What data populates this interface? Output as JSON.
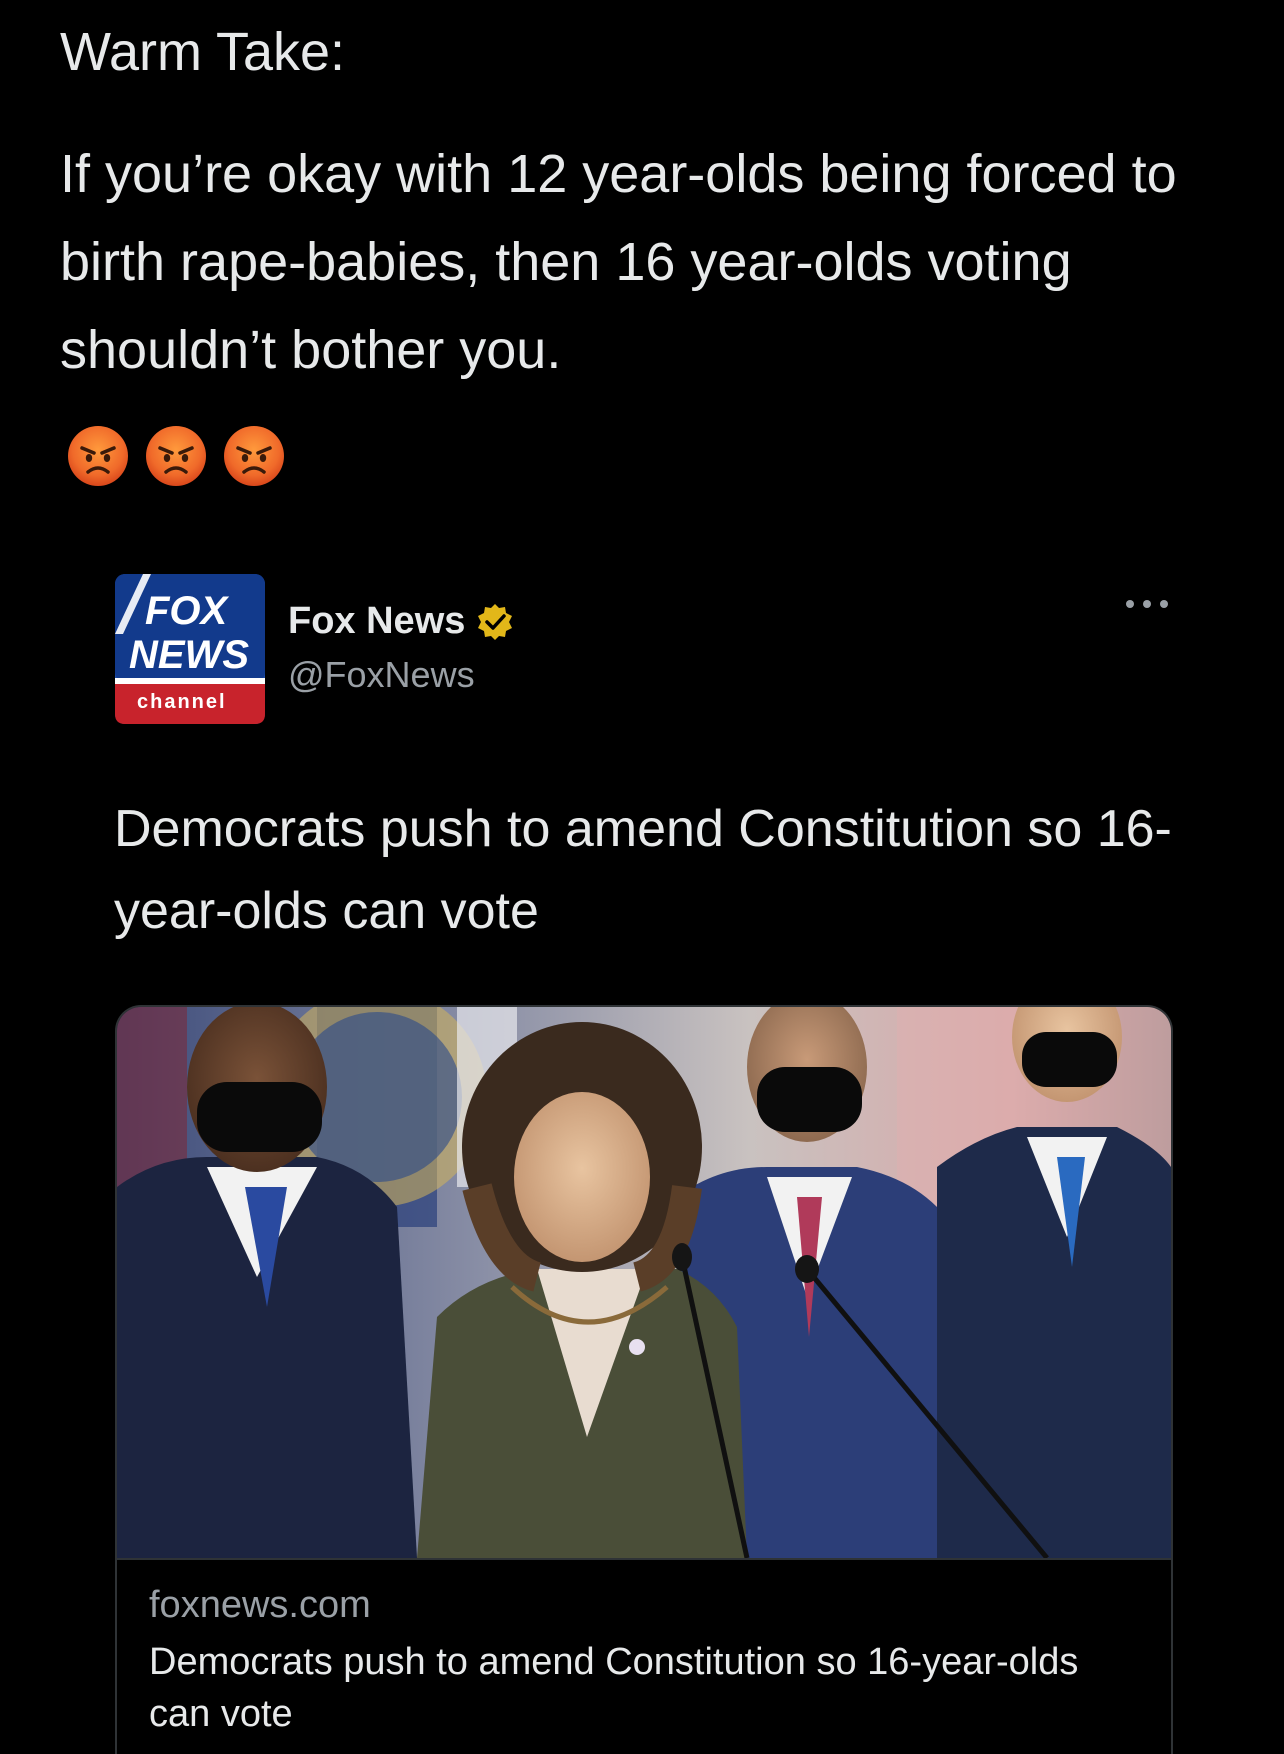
{
  "tweet": {
    "header": "Warm Take:",
    "body": "If you’re okay with 12 year-olds being forced to birth rape-babies, then 16 year-olds voting shouldn’t bother you.",
    "emojis": [
      "angry-face-icon",
      "angry-face-icon",
      "angry-face-icon"
    ]
  },
  "quoted_tweet": {
    "avatar": {
      "logo_line1": "FOX",
      "logo_line2": "NEWS",
      "logo_line3": "channel",
      "brand_color": "#c8232c",
      "navy_color": "#123a8c"
    },
    "name": "Fox News",
    "handle": "@FoxNews",
    "verified_color": "#e2b719",
    "text": "Democrats push to amend Constitution so 16-year-olds can vote",
    "link_card": {
      "image_description_icon": "press-conference-photo",
      "domain": "foxnews.com",
      "title": "Democrats push to amend Constitution so 16-year-olds can vote"
    }
  },
  "colors": {
    "background": "#000000",
    "text": "#e7e9ea",
    "secondary_text": "#9aa0a6",
    "border": "#2f3336"
  }
}
